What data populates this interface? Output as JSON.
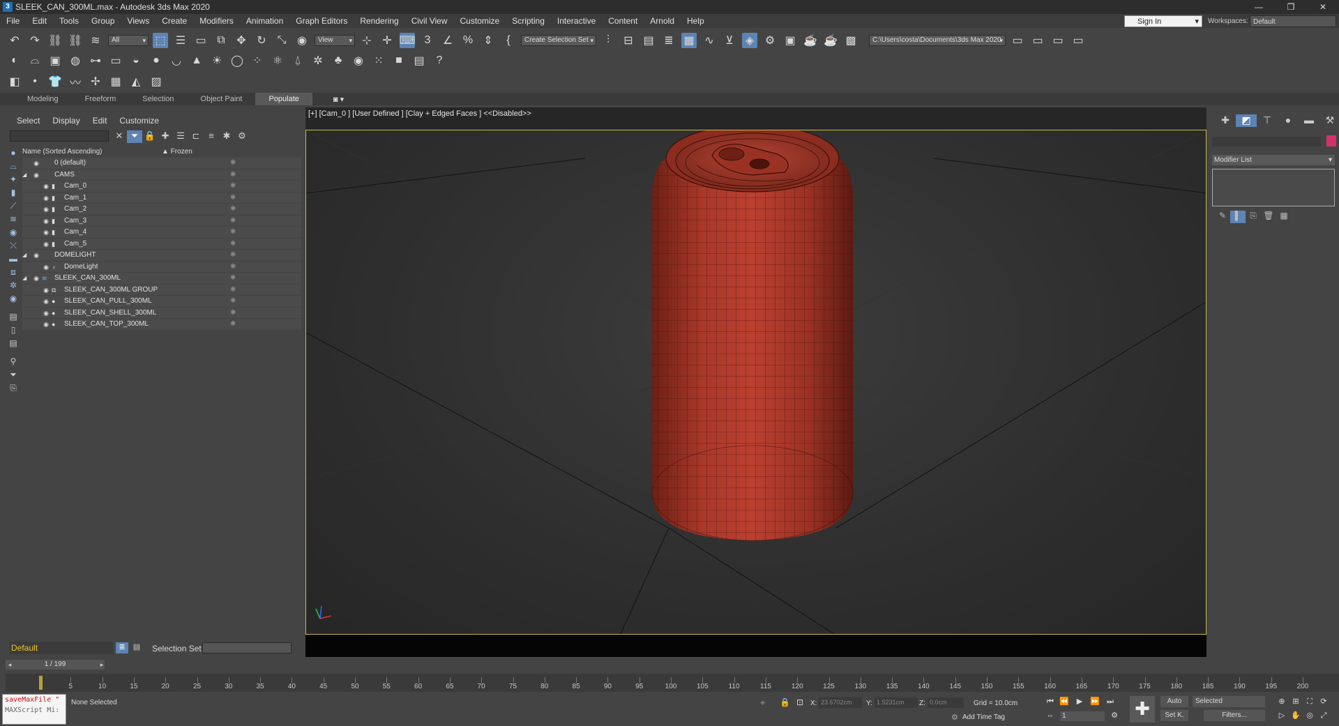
{
  "window": {
    "title": "SLEEK_CAN_300ML.max - Autodesk 3ds Max 2020",
    "app_icon_letter": "3",
    "controls": [
      "—",
      "❐",
      "✕"
    ]
  },
  "menubar": {
    "items": [
      "File",
      "Edit",
      "Tools",
      "Group",
      "Views",
      "Create",
      "Modifiers",
      "Animation",
      "Graph Editors",
      "Rendering",
      "Civil View",
      "Customize",
      "Scripting",
      "Interactive",
      "Content",
      "Arnold",
      "Help"
    ],
    "signin_label": "Sign In",
    "workspaces_label": "Workspaces:",
    "workspace_value": "Default"
  },
  "main_toolbar": {
    "selection_filter": "All",
    "ref_coord": "View",
    "named_selection": "Create Selection Set",
    "project_path": "C:\\Users\\costa\\Documents\\3ds Max 2020"
  },
  "ribbon": {
    "tabs": [
      "Modeling",
      "Freeform",
      "Selection",
      "Object Paint",
      "Populate"
    ],
    "selected": "Populate"
  },
  "scene_explorer": {
    "menus": [
      "Select",
      "Display",
      "Edit",
      "Customize"
    ],
    "column_name": "Name (Sorted Ascending)",
    "column_frozen": "▲ Frozen",
    "rows": [
      {
        "label": "0 (default)",
        "level": 0
      },
      {
        "label": "CAMS",
        "level": 0
      },
      {
        "label": "Cam_0",
        "level": 1
      },
      {
        "label": "Cam_1",
        "level": 1
      },
      {
        "label": "Cam_2",
        "level": 1
      },
      {
        "label": "Cam_3",
        "level": 1
      },
      {
        "label": "Cam_4",
        "level": 1
      },
      {
        "label": "Cam_5",
        "level": 1
      },
      {
        "label": "DOMELIGHT",
        "level": 0
      },
      {
        "label": "DomeLight",
        "level": 1
      },
      {
        "label": "SLEEK_CAN_300ML",
        "level": 0
      },
      {
        "label": "SLEEK_CAN_300ML GROUP",
        "level": 1
      },
      {
        "label": "SLEEK_CAN_PULL_300ML",
        "level": 1
      },
      {
        "label": "SLEEK_CAN_SHELL_300ML",
        "level": 1
      },
      {
        "label": "SLEEK_CAN_TOP_300ML",
        "level": 1
      }
    ]
  },
  "layer_bar": {
    "layer": "Default",
    "selection_set_label": "Selection Set:"
  },
  "viewport": {
    "label": "[+] [Cam_0 ] [User Defined ] [Clay + Edged Faces ]  <<Disabled>>",
    "can_color": "#b13a2a"
  },
  "command_panel": {
    "modifier_list": "Modifier List",
    "object_color": "#d6306c"
  },
  "timeline": {
    "frame_display": "1 / 199",
    "ticks": [
      5,
      10,
      15,
      20,
      25,
      30,
      35,
      40,
      45,
      50,
      55,
      60,
      65,
      70,
      75,
      80,
      85,
      90,
      95,
      100,
      105,
      110,
      115,
      120,
      125,
      130,
      135,
      140,
      145,
      150,
      155,
      160,
      165,
      170,
      175,
      180,
      185,
      190,
      195,
      200
    ]
  },
  "statusbar": {
    "maxscript_line1": "saveMaxFile \"",
    "maxscript_line2": "MAXScript Mi:",
    "status": "None Selected",
    "x_label": "X:",
    "x_value": "23.6702cm",
    "y_label": "Y:",
    "y_value": "1.5231cm",
    "z_label": "Z:",
    "z_value": "0.0cm",
    "grid": "Grid = 10.0cm",
    "add_time_tag": "Add Time Tag",
    "frame_field": "1",
    "auto_label": "Auto",
    "setk_label": "Set K.",
    "selected_label": "Selected",
    "filters_label": "Filters..."
  }
}
